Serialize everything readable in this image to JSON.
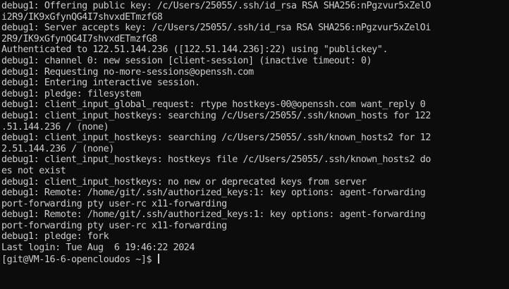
{
  "terminal": {
    "colors": {
      "background": "#0c0c0c",
      "foreground": "#cccccc",
      "cursor": "#cccccc"
    },
    "lines": [
      "debug1: Offering public key: /c/Users/25055/.ssh/id_rsa RSA SHA256:nPgzvur5xZelO",
      "i2R9/IK9xGfynQG4I7shvxdETmzfG8",
      "debug1: Server accepts key: /c/Users/25055/.ssh/id_rsa RSA SHA256:nPgzvur5xZelOi",
      "2R9/IK9xGfynQG4I7shvxdETmzfG8",
      "Authenticated to 122.51.144.236 ([122.51.144.236]:22) using \"publickey\".",
      "debug1: channel 0: new session [client-session] (inactive timeout: 0)",
      "debug1: Requesting no-more-sessions@openssh.com",
      "debug1: Entering interactive session.",
      "debug1: pledge: filesystem",
      "debug1: client_input_global_request: rtype hostkeys-00@openssh.com want_reply 0",
      "debug1: client_input_hostkeys: searching /c/Users/25055/.ssh/known_hosts for 122",
      ".51.144.236 / (none)",
      "debug1: client_input_hostkeys: searching /c/Users/25055/.ssh/known_hosts2 for 12",
      "2.51.144.236 / (none)",
      "debug1: client_input_hostkeys: hostkeys file /c/Users/25055/.ssh/known_hosts2 do",
      "es not exist",
      "debug1: client_input_hostkeys: no new or deprecated keys from server",
      "debug1: Remote: /home/git/.ssh/authorized_keys:1: key options: agent-forwarding",
      "port-forwarding pty user-rc x11-forwarding",
      "debug1: Remote: /home/git/.ssh/authorized_keys:1: key options: agent-forwarding",
      "port-forwarding pty user-rc x11-forwarding",
      "debug1: pledge: fork",
      "Last login: Tue Aug  6 19:46:22 2024"
    ],
    "prompt": "[git@VM-16-6-opencloudos ~]$ "
  }
}
